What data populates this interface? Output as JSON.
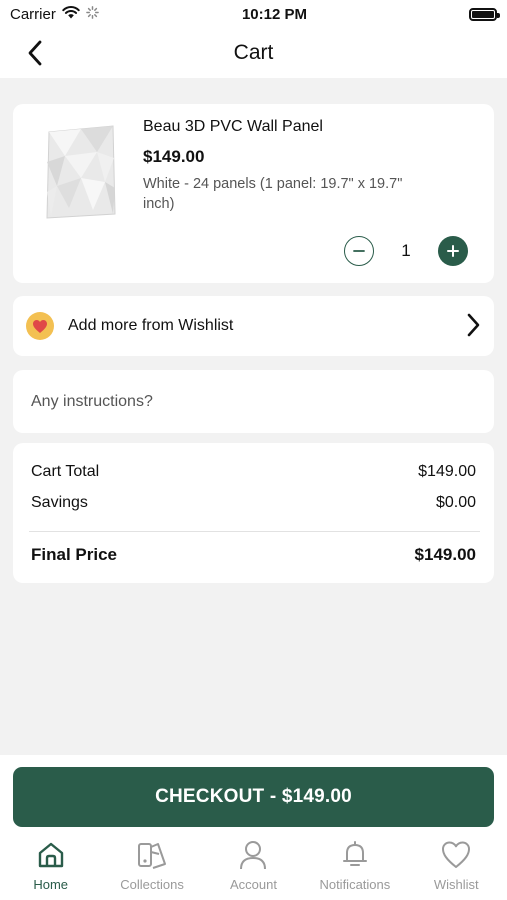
{
  "status_bar": {
    "carrier": "Carrier",
    "time": "10:12 PM"
  },
  "nav": {
    "title": "Cart"
  },
  "cart_item": {
    "name": "Beau 3D PVC Wall Panel",
    "price": "$149.00",
    "variant": "White - 24 panels (1 panel: 19.7\" x 19.7\" inch)",
    "quantity": "1"
  },
  "wishlist_link": {
    "label": "Add more from Wishlist"
  },
  "instructions": {
    "placeholder": "Any instructions?",
    "value": ""
  },
  "summary": {
    "cart_total_label": "Cart Total",
    "cart_total_value": "$149.00",
    "savings_label": "Savings",
    "savings_value": "$0.00",
    "final_label": "Final Price",
    "final_value": "$149.00"
  },
  "checkout": {
    "label": "CHECKOUT - $149.00"
  },
  "tabs": [
    {
      "label": "Home",
      "icon": "home-icon",
      "active": true
    },
    {
      "label": "Collections",
      "icon": "collections-icon",
      "active": false
    },
    {
      "label": "Account",
      "icon": "account-icon",
      "active": false
    },
    {
      "label": "Notifications",
      "icon": "bell-icon",
      "active": false
    },
    {
      "label": "Wishlist",
      "icon": "heart-icon",
      "active": false
    }
  ],
  "colors": {
    "accent": "#2a5c4a",
    "background": "#f2f2f2",
    "badge": "#f3c052",
    "heart": "#e04848",
    "inactive": "#9a9a9a"
  }
}
